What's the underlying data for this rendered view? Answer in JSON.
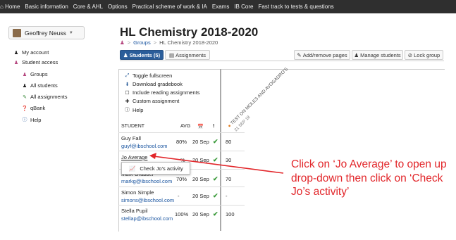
{
  "nav": {
    "items": [
      "Home",
      "Basic information",
      "Core & AHL",
      "Options",
      "Practical scheme of work & IA",
      "Exams",
      "IB Core",
      "Fast track to tests & questions"
    ]
  },
  "user": {
    "name": "Geoffrey Neuss"
  },
  "sidebar": {
    "items": [
      {
        "label": "My account"
      },
      {
        "label": "Student access"
      },
      {
        "label": "Groups"
      },
      {
        "label": "All students"
      },
      {
        "label": "All assignments"
      },
      {
        "label": "qBank"
      },
      {
        "label": "Help"
      }
    ]
  },
  "page": {
    "title": "HL Chemistry 2018-2020"
  },
  "breadcrumb": {
    "groups": "Groups",
    "current": "HL Chemistry 2018-2020"
  },
  "tabs": {
    "students": "Students (5)",
    "assignments": "Assignments"
  },
  "actions": {
    "add_remove": "Add/remove pages",
    "manage": "Manage students",
    "lock": "Lock group"
  },
  "tools": {
    "toggle": "Toggle fullscreen",
    "download": "Download gradebook",
    "include": "Include reading assignments",
    "custom": "Custom assignment",
    "help": "Help"
  },
  "table": {
    "headers": {
      "student": "STUDENT",
      "avg": "AVG",
      "excl": "!"
    },
    "assignment": {
      "title": "TEST ON MOLES AND AVOGADRO'S",
      "date": "21 SEP 18"
    },
    "rows": [
      {
        "name": "Guy Fall",
        "email": "guyf@ibschool.com",
        "avg": "80%",
        "date": "20 Sep",
        "score": "80"
      },
      {
        "name": "Jo Average",
        "email": "",
        "avg": "%",
        "date": "20 Sep",
        "score": "30"
      },
      {
        "name": "Mark Grabber",
        "email": "markg@ibschool.com",
        "avg": "70%",
        "date": "20 Sep",
        "score": "70"
      },
      {
        "name": "Simon Simple",
        "email": "simons@ibschool.com",
        "avg": "-",
        "date": "20 Sep",
        "score": "-"
      },
      {
        "name": "Stella Pupil",
        "email": "stellap@ibschool.com",
        "avg": "100%",
        "date": "20 Sep",
        "score": "100"
      }
    ]
  },
  "popover": {
    "label": "Check Jo's activity"
  },
  "annotation": {
    "text": "Click on ‘Jo Average’ to open up drop-down then click on ‘Check Jo’s activity’"
  },
  "colors": {
    "nav_bg": "#2f2f2f",
    "primary": "#2a5d9a",
    "link": "#1a55a0",
    "tick": "#3a9a3a",
    "annotation": "#e2262a"
  }
}
